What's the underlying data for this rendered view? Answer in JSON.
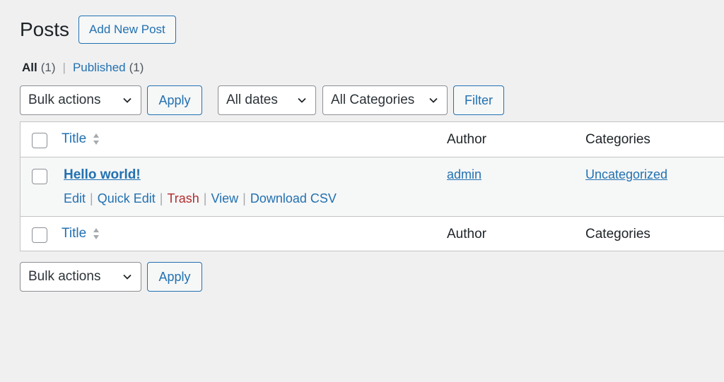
{
  "header": {
    "title": "Posts",
    "add_new_label": "Add New Post"
  },
  "views": [
    {
      "label": "All",
      "count": "(1)",
      "current": true
    },
    {
      "label": "Published",
      "count": "(1)",
      "current": false
    }
  ],
  "views_separator": "|",
  "top_nav": {
    "bulk_actions": "Bulk actions",
    "apply": "Apply",
    "dates": "All dates",
    "categories": "All Categories",
    "filter": "Filter"
  },
  "bottom_nav": {
    "bulk_actions": "Bulk actions",
    "apply": "Apply"
  },
  "table": {
    "columns": {
      "title": "Title",
      "author": "Author",
      "categories": "Categories"
    },
    "rows": [
      {
        "title": "Hello world!",
        "author": "admin",
        "categories": "Uncategorized",
        "actions": {
          "edit": "Edit",
          "quick_edit": "Quick Edit",
          "trash": "Trash",
          "view": "View",
          "download_csv": "Download CSV",
          "separator": "|"
        }
      }
    ]
  },
  "colors": {
    "link": "#2271b1",
    "trash": "#b32d2e",
    "background": "#f0f0f1",
    "border": "#c3c4c7"
  },
  "icons": {
    "sort": "sort-arrows-icon",
    "dropdown": "chevron-down-icon"
  }
}
